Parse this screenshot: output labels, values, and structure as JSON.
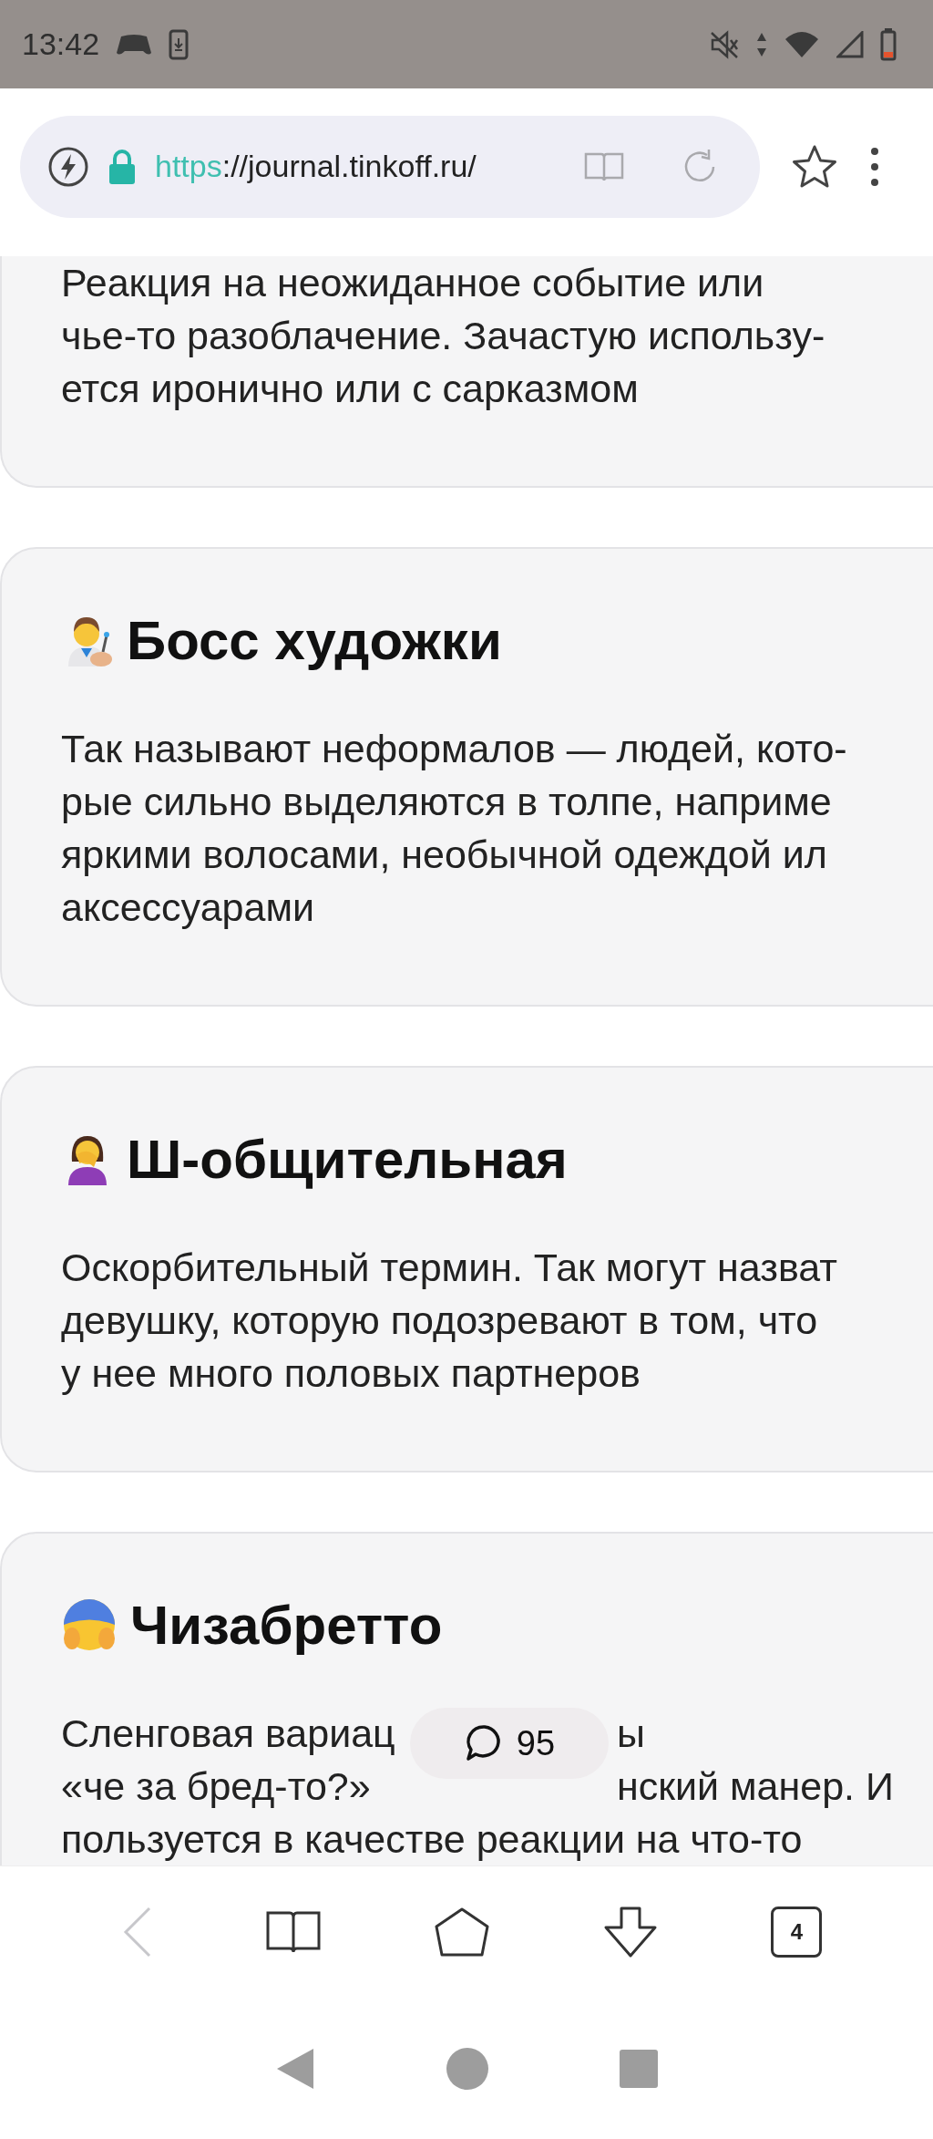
{
  "status_bar": {
    "time": "13:42"
  },
  "address_bar": {
    "scheme": "https",
    "address": "://journal.tinkoff.ru/"
  },
  "cards": [
    {
      "lines": [
        [
          "Реакция на неожиданное событие или"
        ],
        [
          "чье-то разоблачение. Зачастую использу-"
        ],
        [
          "ется иронично или с сарказмом"
        ]
      ]
    },
    {
      "title": "Босс художки",
      "lines": [
        [
          "Так называют неформалов — людей, кото-"
        ],
        [
          "рые сильно выделяются в толпе, наприме"
        ],
        [
          "яркими волосами, необычной одеждой ил"
        ],
        [
          "аксессуарами"
        ]
      ]
    },
    {
      "title": "Ш-общительная",
      "lines": [
        [
          "Оскорбительный термин. Так могут назват"
        ],
        [
          "девушку, которую подозревают в том, что"
        ],
        [
          "у нее много половых партнеров"
        ]
      ]
    },
    {
      "title": "Чизабретто",
      "lines": [
        [
          "Сленговая вариац",
          "ы"
        ],
        [
          "«че за бред-то?»",
          "нский манер. И"
        ],
        [
          "пользуется в качестве реакции на что-то"
        ]
      ]
    }
  ],
  "comments": {
    "count": "95"
  },
  "toolbar": {
    "tabs_count": "4"
  }
}
